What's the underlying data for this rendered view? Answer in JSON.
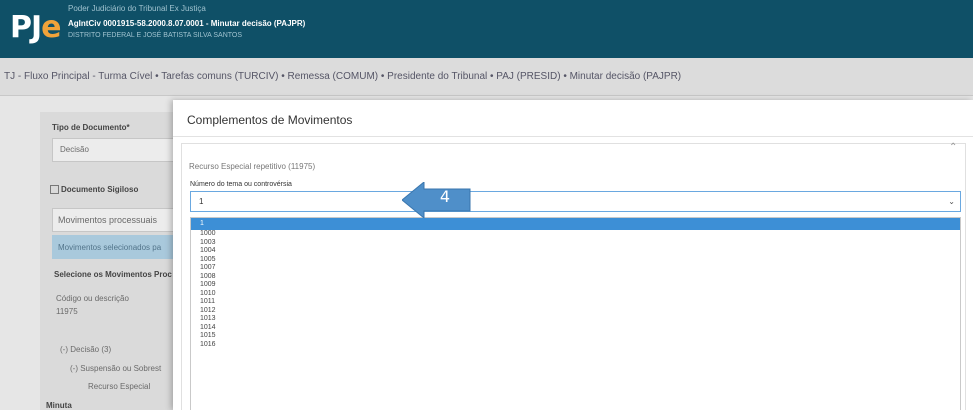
{
  "header": {
    "logo_main": "PJ",
    "logo_accent": "e",
    "line1": "Poder Judiciário do Tribunal Ex Justiça",
    "line2": "AgIntCiv 0001915-58.2000.8.07.0001 - Minutar decisão (PAJPR)",
    "line3": "DISTRITO FEDERAL E JOSÉ BATISTA SILVA SANTOS"
  },
  "breadcrumb": "TJ - Fluxo Principal - Turma Cível • Tarefas comuns (TURCIV) • Remessa (COMUM) • Presidente do Tribunal • PAJ (PRESID) • Minutar decisão (PAJPR)",
  "background_form": {
    "tipo_documento_label": "Tipo de Documento*",
    "tipo_documento_value": "Decisão",
    "sigiloso_label": "Documento Sigiloso",
    "tab_movimentos": "Movimentos processuais",
    "tab_selected": "Movimentos selecionados pa",
    "selecione_label": "Selecione os Movimentos Proc",
    "codigo_label": "Código ou descrição",
    "codigo_value": "11975",
    "tree1": "(-) Decisão (3)",
    "tree2": "(-) Suspensão ou Sobrest",
    "tree3": "Recurso Especial",
    "minuta_label": "Minuta"
  },
  "modal": {
    "title": "Complementos de Movimentos",
    "section_title": "Recurso Especial repetitivo (11975)",
    "field_label": "Número do tema ou controvérsia",
    "selected_value": "1",
    "options": [
      "1",
      "1000",
      "1003",
      "1004",
      "1005",
      "1007",
      "1008",
      "1009",
      "1010",
      "1011",
      "1012",
      "1013",
      "1014",
      "1015",
      "1016"
    ],
    "selected_option_index": 0
  },
  "callout": {
    "label": "4",
    "color": "#4f8fc9"
  },
  "colors": {
    "header_bg": "#0f5067",
    "logo_accent": "#f0a33a",
    "selected_option_bg": "#3d8fd6"
  }
}
